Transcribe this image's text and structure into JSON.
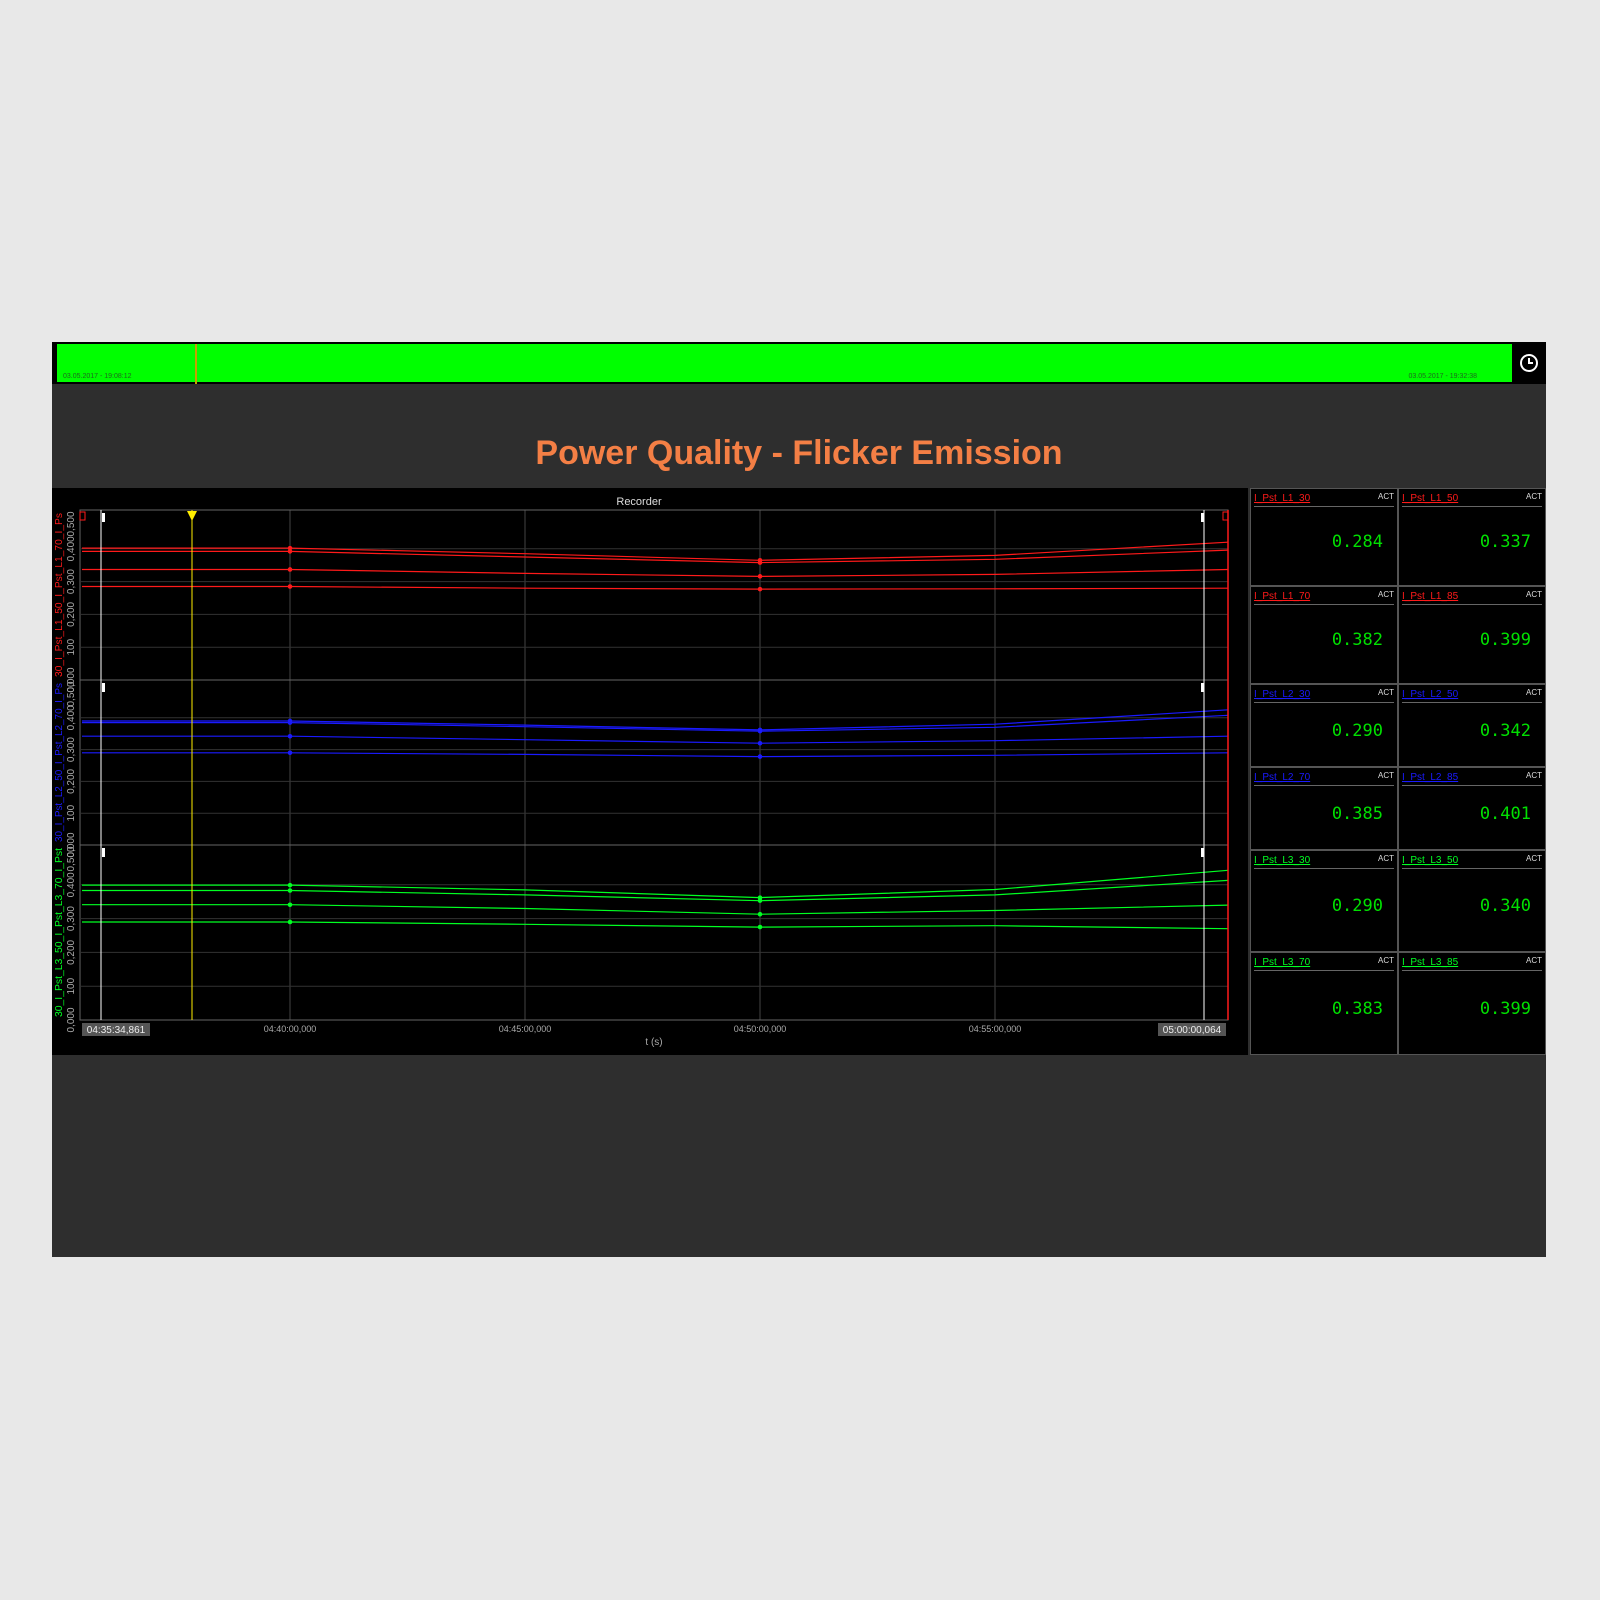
{
  "timebar": {
    "start_label": "03.05.2017 - 19:08:12",
    "end_label": "03.05.2017 - 19:32:38",
    "cursor_fraction": 0.095
  },
  "page_title": "Power Quality - Flicker Emission",
  "recorder": {
    "title": "Recorder",
    "x_axis_label": "t (s)",
    "x_start_label": "04:35:34,861",
    "x_end_label": "05:00:00,064",
    "x_tick_labels": [
      "04:40:00,000",
      "04:45:00,000",
      "04:50:00,000",
      "04:55:00,000"
    ],
    "y_tick_labels": [
      "0,000",
      "100",
      "0,200",
      "0,300",
      "0,400",
      "0,500"
    ],
    "channel_labels": [
      "30_I_Pst_L1_50_I_Pst_L1_70_I_Ps",
      "30_I_Pst_L2_50_I_Pst_L2_70_I_Ps",
      "30_I_Pst_L3_50_I_Pst_L3_70_I_Pst"
    ],
    "colors": {
      "L1": "#ff1a1a",
      "L2": "#1a1aff",
      "L3": "#00ff22",
      "cursor": "#ffee00"
    }
  },
  "chart_data": {
    "type": "line",
    "title": "Recorder",
    "xlabel": "t (s)",
    "x_range": [
      "04:35:34,861",
      "05:00:00,064"
    ],
    "x": [
      "04:35:34,861",
      "04:40:00,000",
      "04:45:00,000",
      "04:50:00,000",
      "04:55:00,000",
      "05:00:00,064"
    ],
    "ylim": [
      0,
      0.5
    ],
    "grid": true,
    "panels": [
      {
        "name": "L1",
        "color": "#ff1a1a",
        "series": [
          {
            "name": "I_Pst_L1_30",
            "values": [
              0.285,
              0.285,
              0.28,
              0.277,
              0.278,
              0.28
            ]
          },
          {
            "name": "I_Pst_L1_50",
            "values": [
              0.337,
              0.337,
              0.325,
              0.316,
              0.322,
              0.337
            ]
          },
          {
            "name": "I_Pst_L1_70",
            "values": [
              0.392,
              0.392,
              0.375,
              0.358,
              0.368,
              0.396
            ]
          },
          {
            "name": "I_Pst_L1_85",
            "values": [
              0.402,
              0.402,
              0.385,
              0.365,
              0.38,
              0.42
            ]
          }
        ]
      },
      {
        "name": "L2",
        "color": "#1a1aff",
        "series": [
          {
            "name": "I_Pst_L2_30",
            "values": [
              0.29,
              0.29,
              0.285,
              0.278,
              0.282,
              0.29
            ]
          },
          {
            "name": "I_Pst_L2_50",
            "values": [
              0.342,
              0.342,
              0.331,
              0.32,
              0.328,
              0.342
            ]
          },
          {
            "name": "I_Pst_L2_70",
            "values": [
              0.385,
              0.385,
              0.372,
              0.358,
              0.37,
              0.408
            ]
          },
          {
            "name": "I_Pst_L2_85",
            "values": [
              0.39,
              0.39,
              0.377,
              0.362,
              0.38,
              0.425
            ]
          }
        ]
      },
      {
        "name": "L3",
        "color": "#00ff22",
        "series": [
          {
            "name": "I_Pst_L3_30",
            "values": [
              0.29,
              0.29,
              0.283,
              0.275,
              0.279,
              0.27
            ]
          },
          {
            "name": "I_Pst_L3_50",
            "values": [
              0.341,
              0.341,
              0.33,
              0.313,
              0.324,
              0.34
            ]
          },
          {
            "name": "I_Pst_L3_70",
            "values": [
              0.383,
              0.383,
              0.37,
              0.353,
              0.37,
              0.413
            ]
          },
          {
            "name": "I_Pst_L3_85",
            "values": [
              0.399,
              0.399,
              0.385,
              0.362,
              0.386,
              0.443
            ]
          }
        ]
      }
    ]
  },
  "tiles": [
    {
      "name": "I_Pst_L1_30",
      "act": "ACT",
      "value": "0.284",
      "color": "#ff1a1a"
    },
    {
      "name": "I_Pst_L1_50",
      "act": "ACT",
      "value": "0.337",
      "color": "#ff1a1a"
    },
    {
      "name": "I_Pst_L1_70",
      "act": "ACT",
      "value": "0.382",
      "color": "#ff1a1a"
    },
    {
      "name": "I_Pst_L1_85",
      "act": "ACT",
      "value": "0.399",
      "color": "#ff1a1a"
    },
    {
      "name": "I_Pst_L2_30",
      "act": "ACT",
      "value": "0.290",
      "color": "#1a1aff"
    },
    {
      "name": "I_Pst_L2_50",
      "act": "ACT",
      "value": "0.342",
      "color": "#1a1aff"
    },
    {
      "name": "I_Pst_L2_70",
      "act": "ACT",
      "value": "0.385",
      "color": "#1a1aff"
    },
    {
      "name": "I_Pst_L2_85",
      "act": "ACT",
      "value": "0.401",
      "color": "#1a1aff"
    },
    {
      "name": "I_Pst_L3_30",
      "act": "ACT",
      "value": "0.290",
      "color": "#00ff22"
    },
    {
      "name": "I_Pst_L3_50",
      "act": "ACT",
      "value": "0.340",
      "color": "#00ff22"
    },
    {
      "name": "I_Pst_L3_70",
      "act": "ACT",
      "value": "0.383",
      "color": "#00ff22"
    },
    {
      "name": "I_Pst_L3_85",
      "act": "ACT",
      "value": "0.399",
      "color": "#00ff22"
    }
  ]
}
